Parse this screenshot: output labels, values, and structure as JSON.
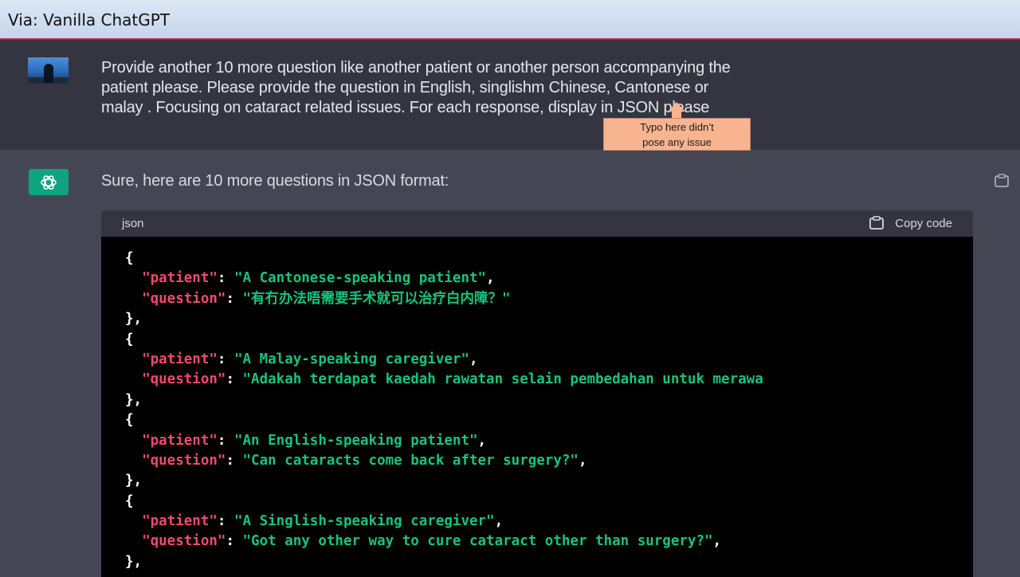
{
  "window": {
    "title": "Via: Vanilla ChatGPT"
  },
  "user_message": {
    "lines": [
      "Provide another 10 more question  like another patient or another person accompanying the",
      "patient please. Please provide the question in English, singlishm Chinese, Cantonese or",
      "malay . Focusing  on cataract related issues.  For each response, display in JSON please"
    ]
  },
  "annotation": {
    "lines": [
      "Typo here didn’t",
      "pose any issue"
    ],
    "color": "#f8b48f"
  },
  "assistant_message": {
    "intro": "Sure, here are 10 more questions in JSON format:",
    "code": {
      "language": "json",
      "copy_label": "Copy code",
      "entries": [
        {
          "patient": "A Cantonese-speaking patient",
          "question": "有冇办法唔需要手术就可以治疗白内障？"
        },
        {
          "patient": "A Malay-speaking caregiver",
          "question": "Adakah terdapat kaedah rawatan selain pembedahan untuk merawa"
        },
        {
          "patient": "An English-speaking patient",
          "question": "Can cataracts come back after surgery?"
        },
        {
          "patient": "A Singlish-speaking caregiver",
          "question": "Got any other way to cure cataract other than surgery?"
        }
      ],
      "key_patient": "\"patient\"",
      "key_question": "\"question\""
    }
  },
  "colors": {
    "user_bg": "#343541",
    "assistant_bg": "#444654",
    "code_bg": "#000000",
    "key": "#ef4a6b",
    "string": "#19c37d",
    "brand": "#10a37f"
  },
  "icons": [
    "user-avatar",
    "openai-logo-icon",
    "clipboard-icon"
  ]
}
